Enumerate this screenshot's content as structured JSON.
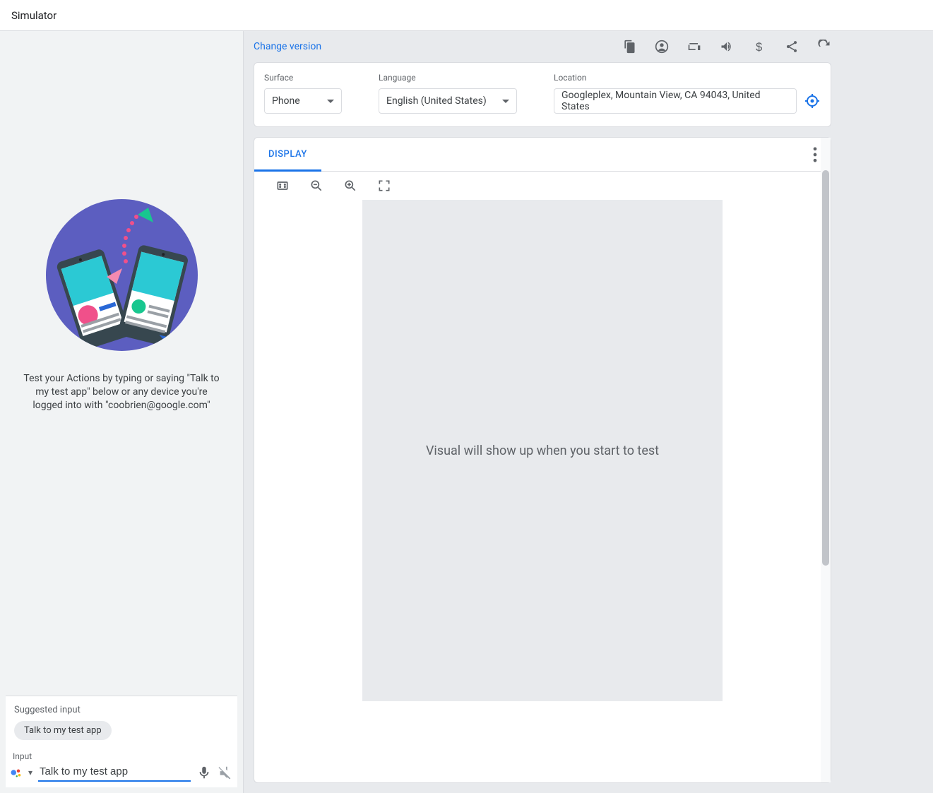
{
  "page": {
    "title": "Simulator"
  },
  "left_panel": {
    "intro_text": "Test your Actions by typing or saying \"Talk to my test app\" below or any device you're logged into with \"coobrien@google.com\"",
    "suggested_label": "Suggested input",
    "suggested_chip": "Talk to my test app",
    "input_label": "Input",
    "input_value": "Talk to my test app"
  },
  "topbar": {
    "change_version": "Change version"
  },
  "settings": {
    "surface_label": "Surface",
    "surface_value": "Phone",
    "language_label": "Language",
    "language_value": "English (United States)",
    "location_label": "Location",
    "location_value": "Googleplex, Mountain View, CA 94043, United States"
  },
  "display": {
    "tab_label": "DISPLAY",
    "placeholder": "Visual will show up when you start to test"
  }
}
